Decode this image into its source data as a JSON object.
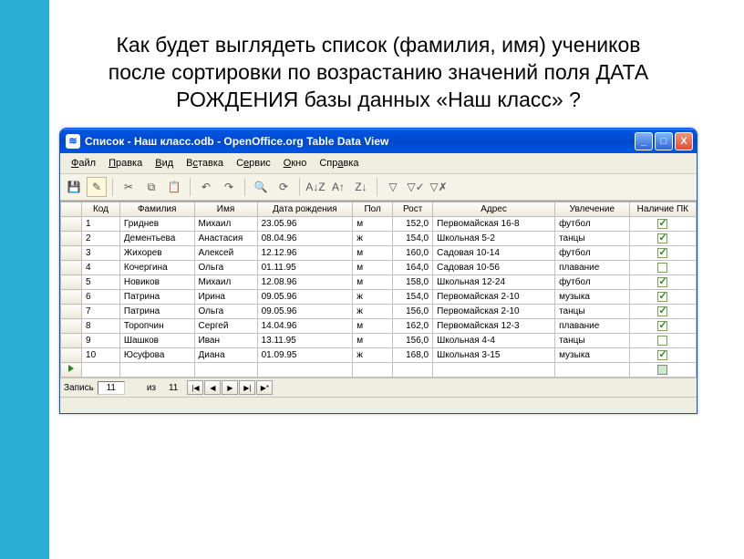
{
  "question": "Как будет выглядеть список (фамилия, имя) учеников после сортировки по возрастанию значений поля ДАТА РОЖДЕНИЯ базы данных «Наш класс» ?",
  "window": {
    "title": "Список - Наш класс.odb - OpenOffice.org Table Data View",
    "minimize": "_",
    "maximize": "□",
    "close": "X"
  },
  "menu": {
    "file": "Файл",
    "edit": "Правка",
    "view": "Вид",
    "insert": "Вставка",
    "tools": "Сервис",
    "window": "Окно",
    "help": "Справка"
  },
  "columns": [
    "Код",
    "Фамилия",
    "Имя",
    "Дата рождения",
    "Пол",
    "Рост",
    "Адрес",
    "Увлечение",
    "Наличие ПК"
  ],
  "rows": [
    {
      "id": "1",
      "fam": "Гриднев",
      "name": "Михаил",
      "dob": "23.05.96",
      "sex": "м",
      "h": "152,0",
      "addr": "Первомайская 16-8",
      "hobby": "футбол",
      "pc": true
    },
    {
      "id": "2",
      "fam": "Дементьева",
      "name": "Анастасия",
      "dob": "08.04.96",
      "sex": "ж",
      "h": "154,0",
      "addr": "Школьная 5-2",
      "hobby": "танцы",
      "pc": true
    },
    {
      "id": "3",
      "fam": "Жихорев",
      "name": "Алексей",
      "dob": "12.12.96",
      "sex": "м",
      "h": "160,0",
      "addr": "Садовая 10-14",
      "hobby": "футбол",
      "pc": true
    },
    {
      "id": "4",
      "fam": "Кочергина",
      "name": "Ольга",
      "dob": "01.11.95",
      "sex": "м",
      "h": "164,0",
      "addr": "Садовая 10-56",
      "hobby": "плавание",
      "pc": false
    },
    {
      "id": "5",
      "fam": "Новиков",
      "name": "Михаил",
      "dob": "12.08.96",
      "sex": "м",
      "h": "158,0",
      "addr": "Школьная 12-24",
      "hobby": "футбол",
      "pc": true
    },
    {
      "id": "6",
      "fam": "Патрина",
      "name": "Ирина",
      "dob": "09.05.96",
      "sex": "ж",
      "h": "154,0",
      "addr": "Первомайская 2-10",
      "hobby": "музыка",
      "pc": true
    },
    {
      "id": "7",
      "fam": "Патрина",
      "name": "Ольга",
      "dob": "09.05.96",
      "sex": "ж",
      "h": "156,0",
      "addr": "Первомайская 2-10",
      "hobby": "танцы",
      "pc": true
    },
    {
      "id": "8",
      "fam": "Торопчин",
      "name": "Сергей",
      "dob": "14.04.96",
      "sex": "м",
      "h": "162,0",
      "addr": "Первомайская 12-3",
      "hobby": "плавание",
      "pc": true
    },
    {
      "id": "9",
      "fam": "Шашков",
      "name": "Иван",
      "dob": "13.11.95",
      "sex": "м",
      "h": "156,0",
      "addr": "Школьная 4-4",
      "hobby": "танцы",
      "pc": false
    },
    {
      "id": "10",
      "fam": "Юсуфова",
      "name": "Диана",
      "dob": "01.09.95",
      "sex": "ж",
      "h": "168,0",
      "addr": "Школьная 3-15",
      "hobby": "музыка",
      "pc": true
    }
  ],
  "nav": {
    "label_record": "Запись",
    "current": "11",
    "of": "из",
    "total": "11",
    "first": "|◀",
    "prev": "◀",
    "next": "▶",
    "last": "▶|",
    "new": "▶*"
  },
  "toolbar_icons": [
    "save",
    "edit",
    "cut",
    "copy",
    "paste",
    "undo",
    "redo",
    "find",
    "refresh",
    "sort-asc",
    "sort-desc",
    "filter",
    "autofilter",
    "remove-filter"
  ]
}
